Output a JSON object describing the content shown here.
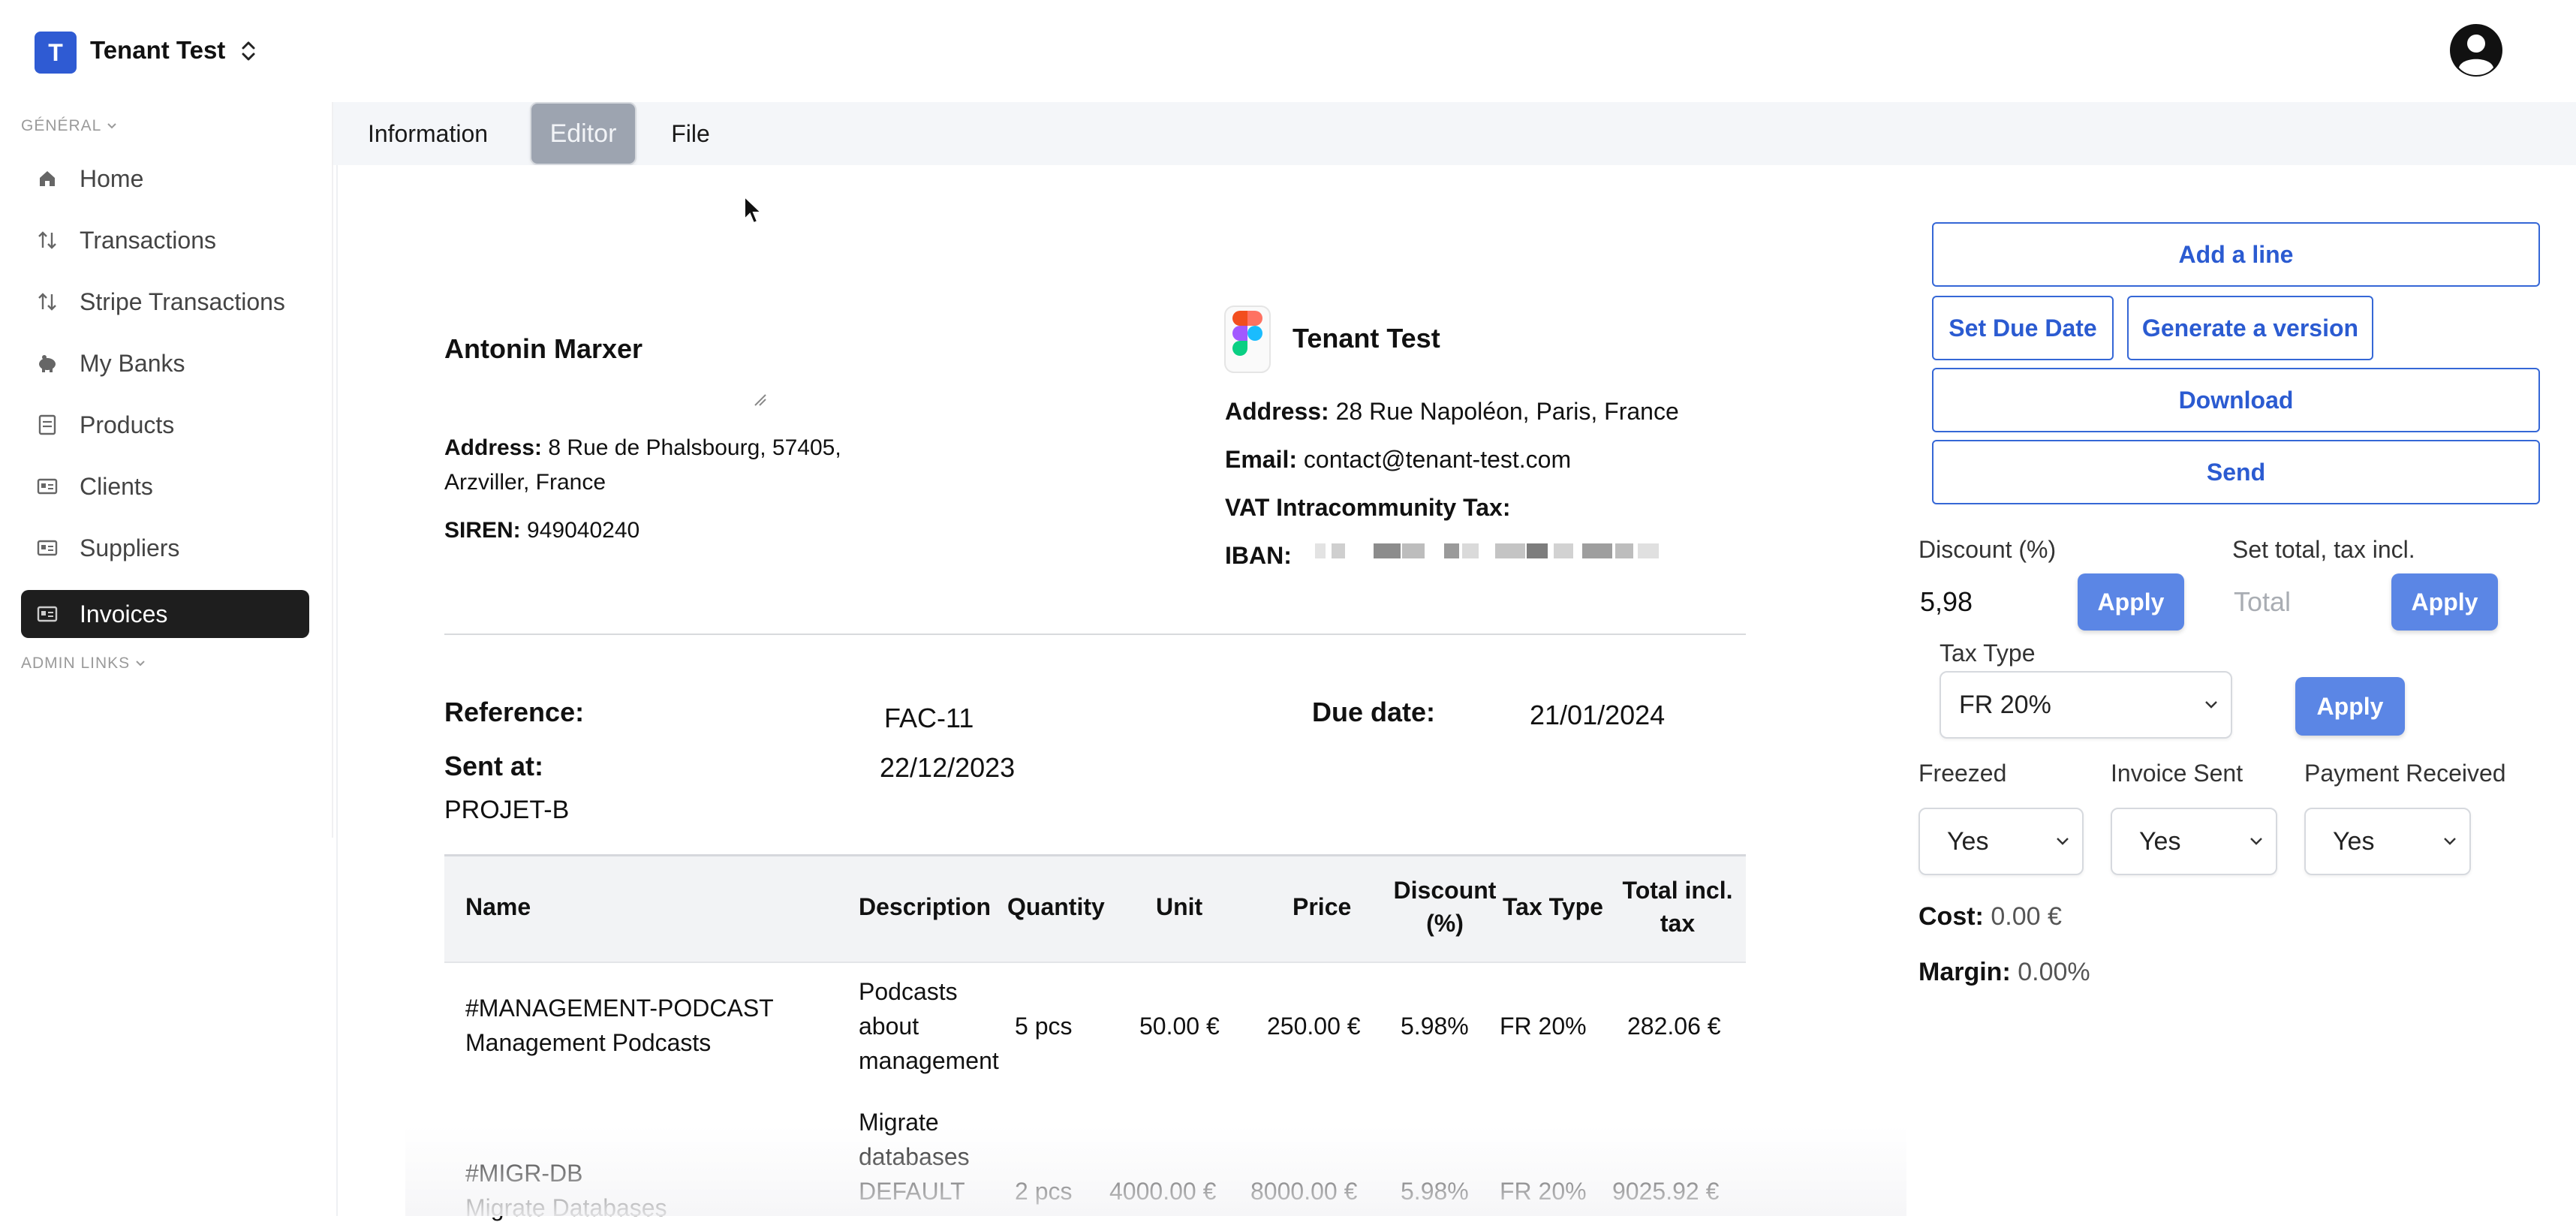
{
  "app": {
    "tenant_initial": "T",
    "tenant_name": "Tenant Test"
  },
  "sidebar": {
    "section_general": "GÉNÉRAL",
    "section_admin": "ADMIN LINKS",
    "items": [
      {
        "label": "Home",
        "icon": "home-icon"
      },
      {
        "label": "Transactions",
        "icon": "sort-arrows-icon"
      },
      {
        "label": "Stripe Transactions",
        "icon": "sort-arrows-icon"
      },
      {
        "label": "My Banks",
        "icon": "piggy-bank-icon"
      },
      {
        "label": "Products",
        "icon": "list-icon"
      },
      {
        "label": "Clients",
        "icon": "id-card-icon"
      },
      {
        "label": "Suppliers",
        "icon": "id-card-icon"
      },
      {
        "label": "Invoices",
        "icon": "id-card-icon",
        "active": true
      }
    ]
  },
  "tabs": [
    {
      "label": "Information"
    },
    {
      "label": "Editor",
      "selected": true
    },
    {
      "label": "File"
    }
  ],
  "client": {
    "name": "Antonin Marxer",
    "address_label": "Address:",
    "address_line1": "8 Rue de Phalsbourg, 57405,",
    "address_line2": "Arzviller, France",
    "siren_label": "SIREN:",
    "siren": "949040240"
  },
  "company": {
    "name": "Tenant Test",
    "address_label": "Address:",
    "address": "28 Rue Napoléon, Paris, France",
    "email_label": "Email:",
    "email": "contact@tenant-test.com",
    "vat_label": "VAT Intracommunity Tax:",
    "iban_label": "IBAN:"
  },
  "invoice": {
    "reference_label": "Reference:",
    "reference": "FAC-11",
    "due_label": "Due date:",
    "due": "21/01/2024",
    "sent_label": "Sent at:",
    "sent": "22/12/2023",
    "project": "PROJET-B"
  },
  "table": {
    "headers": {
      "name": "Name",
      "description": "Description",
      "quantity": "Quantity",
      "unit": "Unit",
      "price": "Price",
      "discount_1": "Discount",
      "discount_2": "(%)",
      "tax_type": "Tax Type",
      "total_1": "Total incl.",
      "total_2": "tax"
    },
    "rows": [
      {
        "code": "#MANAGEMENT-PODCAST",
        "name": "Management Podcasts",
        "desc1": "Podcasts",
        "desc2": "about",
        "desc3": "management",
        "quantity": "5 pcs",
        "unit": "50.00 €",
        "price": "250.00 €",
        "discount": "5.98%",
        "tax_type": "FR 20%",
        "total": "282.06 €"
      },
      {
        "code": "#MIGR-DB",
        "name": "Migrate Databases",
        "desc1": "Migrate",
        "desc2": "databases",
        "desc3": "DEFAULT",
        "quantity": "2 pcs",
        "unit": "4000.00 €",
        "price": "8000.00 €",
        "discount": "5.98%",
        "tax_type": "FR 20%",
        "total": "9025.92 €"
      }
    ]
  },
  "actions": {
    "add_line": "Add a line",
    "set_due_date": "Set Due Date",
    "generate_version": "Generate a version",
    "download": "Download",
    "send": "Send"
  },
  "discount": {
    "label": "Discount (%)",
    "value": "5,98",
    "apply": "Apply"
  },
  "set_total": {
    "label": "Set total, tax incl.",
    "placeholder": "Total",
    "apply": "Apply"
  },
  "tax": {
    "label": "Tax Type",
    "value": "FR 20%",
    "apply": "Apply"
  },
  "flags": {
    "freezed_label": "Freezed",
    "freezed": "Yes",
    "sent_label": "Invoice Sent",
    "sent": "Yes",
    "paid_label": "Payment Received",
    "paid": "Yes"
  },
  "summary": {
    "cost_label": "Cost:",
    "cost": "0.00 €",
    "margin_label": "Margin:",
    "margin": "0.00%"
  },
  "colors": {
    "accent": "#3567d6",
    "button_fill": "#5b86e5",
    "sidebar_active": "#1e1e1e",
    "tab_selected": "#9da4b0"
  }
}
